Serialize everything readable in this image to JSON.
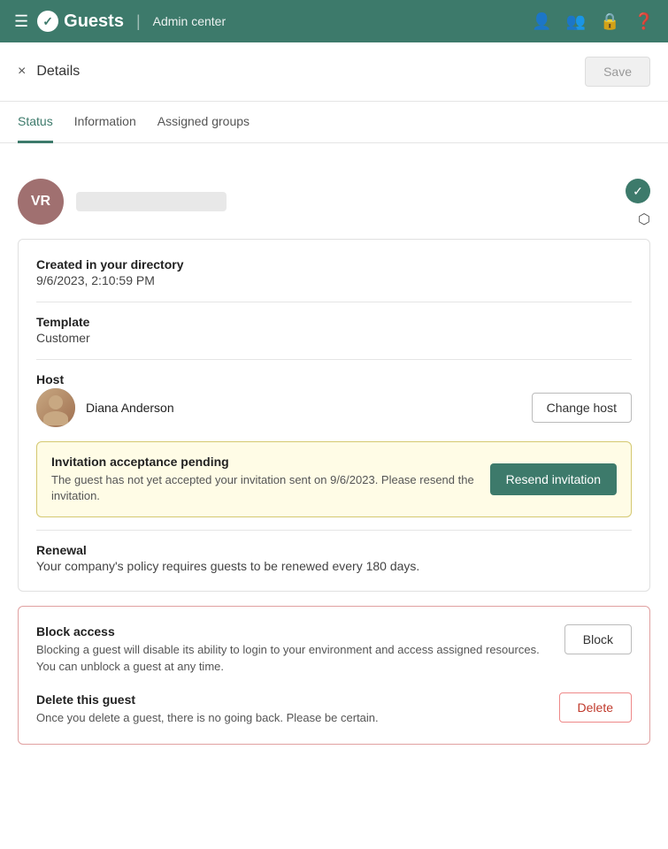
{
  "topnav": {
    "app_name": "Guests",
    "section": "Admin center",
    "icons": [
      "people-icon",
      "group-icon",
      "user-shield-icon",
      "help-icon"
    ]
  },
  "header": {
    "close_label": "×",
    "title": "Details",
    "save_label": "Save"
  },
  "tabs": [
    {
      "id": "status",
      "label": "Status",
      "active": true
    },
    {
      "id": "information",
      "label": "Information",
      "active": false
    },
    {
      "id": "assigned-groups",
      "label": "Assigned groups",
      "active": false
    }
  ],
  "profile": {
    "initials": "VR",
    "avatar_bg": "#a07070"
  },
  "status": {
    "created_label": "Created in your directory",
    "created_value": "9/6/2023, 2:10:59 PM",
    "template_label": "Template",
    "template_value": "Customer",
    "host_label": "Host",
    "host_name": "Diana Anderson",
    "change_host_label": "Change host",
    "invitation_title": "Invitation acceptance pending",
    "invitation_desc": "The guest has not yet accepted your invitation sent on 9/6/2023. Please resend the invitation.",
    "resend_label": "Resend invitation",
    "renewal_label": "Renewal",
    "renewal_desc": "Your company's policy requires guests to be renewed every 180 days."
  },
  "danger_zone": {
    "block_label": "Block access",
    "block_desc": "Blocking a guest will disable its ability to login to your environment and access assigned resources. You can unblock a guest at any time.",
    "block_btn_label": "Block",
    "delete_label": "Delete this guest",
    "delete_desc": "Once you delete a guest, there is no going back. Please be certain.",
    "delete_btn_label": "Delete"
  }
}
